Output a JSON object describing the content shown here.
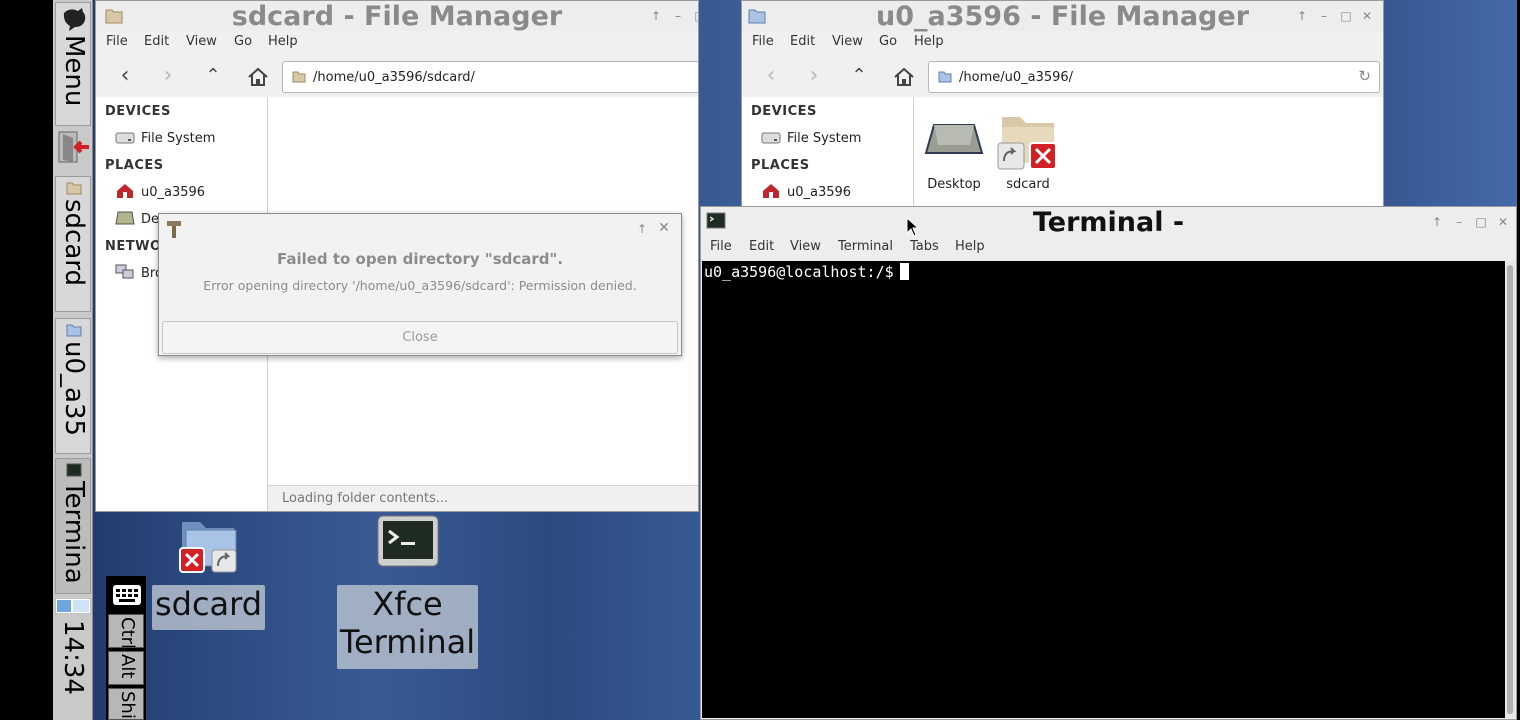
{
  "panel": {
    "menu_label": "Menu",
    "tasks": [
      {
        "label": "sdcard"
      },
      {
        "label": "u0_a35"
      },
      {
        "label": "Termina"
      }
    ],
    "clock": "14:34"
  },
  "fm_left": {
    "title": "sdcard - File Manager",
    "menu": [
      "File",
      "Edit",
      "View",
      "Go",
      "Help"
    ],
    "address": "/home/u0_a3596/sdcard/",
    "sidebar": {
      "devices_heading": "DEVICES",
      "places_heading": "PLACES",
      "network_heading": "NETWO",
      "file_system": "File System",
      "home": "u0_a3596",
      "desktop": "Des",
      "browse": "Bro"
    },
    "status": "Loading folder contents..."
  },
  "fm_right": {
    "title": "u0_a3596 - File Manager",
    "menu": [
      "File",
      "Edit",
      "View",
      "Go",
      "Help"
    ],
    "address": "/home/u0_a3596/",
    "sidebar": {
      "devices_heading": "DEVICES",
      "places_heading": "PLACES",
      "file_system": "File System",
      "home": "u0_a3596"
    },
    "items": [
      {
        "label": "Desktop"
      },
      {
        "label": "sdcard"
      }
    ]
  },
  "dialog": {
    "title": "Failed to open directory \"sdcard\".",
    "message": "Error opening directory '/home/u0_a3596/sdcard': Permission denied.",
    "close_label": "Close"
  },
  "terminal": {
    "title": "Terminal -",
    "menu": [
      "File",
      "Edit",
      "View",
      "Terminal",
      "Tabs",
      "Help"
    ],
    "prompt": "u0_a3596@localhost:/$"
  },
  "desktop_icons": [
    {
      "label": "sdcard"
    },
    {
      "label_line1": "Xfce",
      "label_line2": "Terminal"
    }
  ],
  "keys": [
    "Ctrl",
    "Alt",
    "Shift"
  ],
  "colors": {
    "error_red": "#d22027",
    "home_red": "#c0262c",
    "folder_tan": "#d8c8a8"
  }
}
